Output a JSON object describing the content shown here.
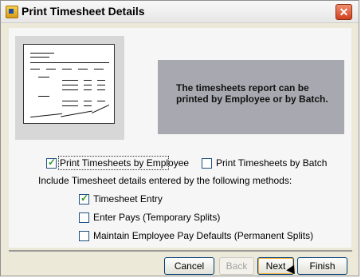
{
  "window": {
    "title": "Print Timesheet Details",
    "close_glyph": "✕"
  },
  "info": {
    "text": "The timesheets report can be printed by Employee or by Batch."
  },
  "options": {
    "by_employee": {
      "label": "Print Timesheets by Employee",
      "checked": true
    },
    "by_batch": {
      "label": "Print Timesheets by Batch",
      "checked": false
    },
    "methods_label": "Include Timesheet details entered by the following methods:",
    "methods": [
      {
        "label": "Timesheet Entry",
        "checked": true
      },
      {
        "label": "Enter Pays (Temporary Splits)",
        "checked": false
      },
      {
        "label": "Maintain Employee Pay Defaults (Permanent Splits)",
        "checked": false
      }
    ]
  },
  "buttons": {
    "cancel": "Cancel",
    "back": "Back",
    "next": "Next",
    "finish": "Finish"
  },
  "colors": {
    "info_box_bg": "#a8a8b0",
    "close_red": "#d0401d",
    "check_green": "#2a9a2a"
  },
  "icons": {
    "app": "app-icon",
    "close": "close-icon",
    "report_preview": "report-preview-icon",
    "cursor": "mouse-pointer-icon"
  }
}
